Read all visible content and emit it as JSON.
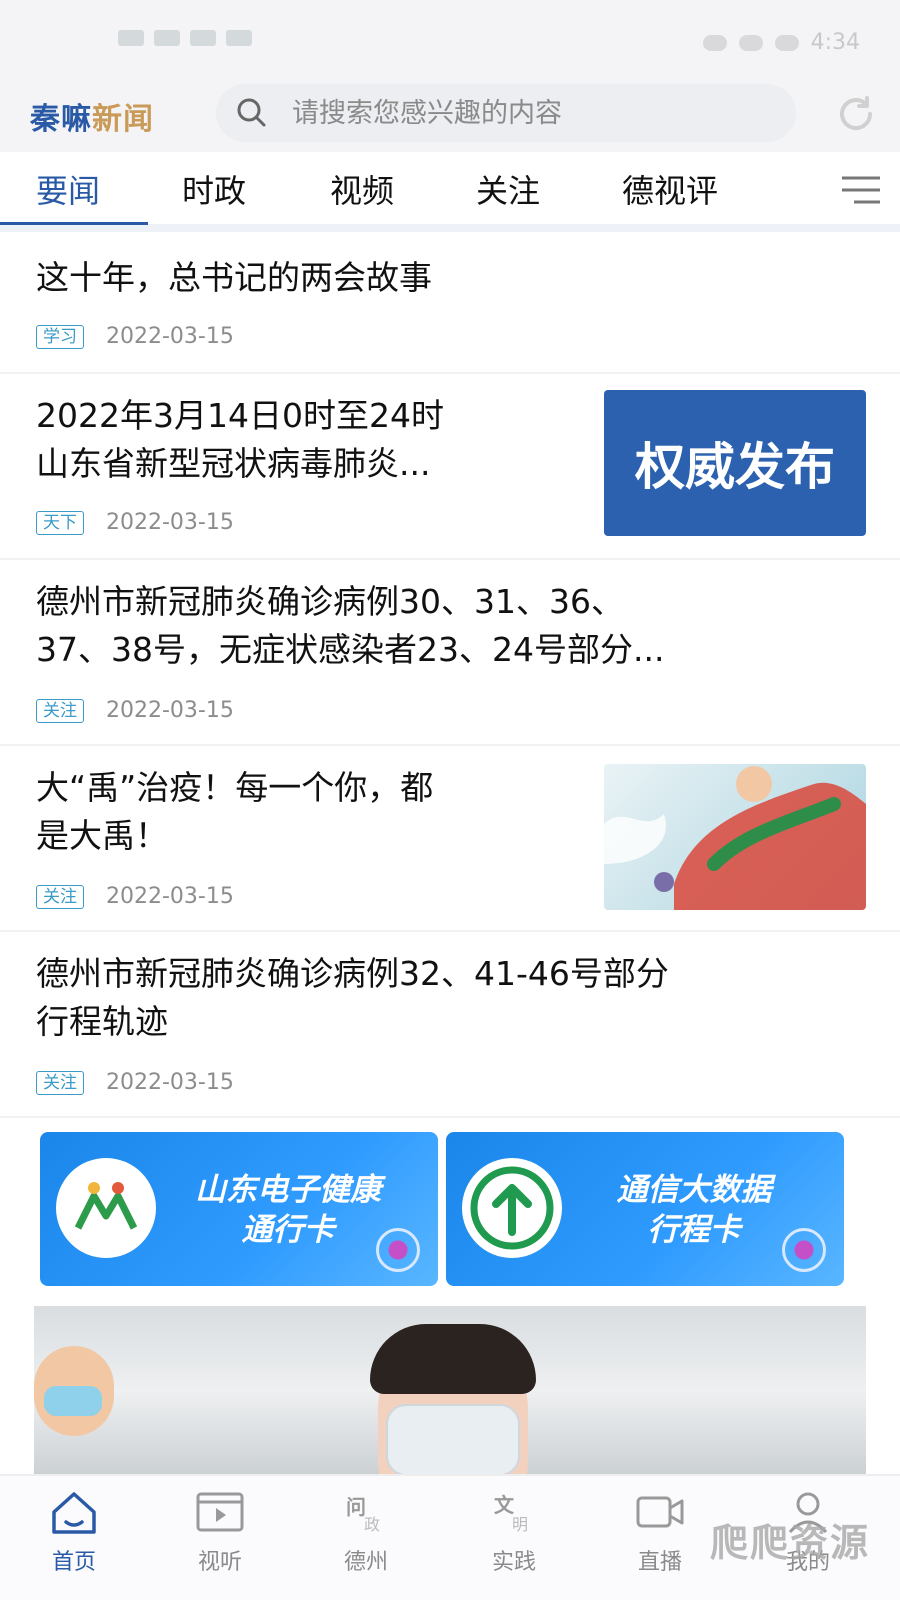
{
  "status_bar": {
    "time": "4:34"
  },
  "header": {
    "logo_part1": "秦嘛",
    "logo_part2": "新闻",
    "search_placeholder": "请搜索您感兴趣的内容"
  },
  "tabs": [
    {
      "label": "要闻",
      "active": true
    },
    {
      "label": "时政"
    },
    {
      "label": "视频"
    },
    {
      "label": "关注"
    },
    {
      "label": "德视评"
    }
  ],
  "news": [
    {
      "title_lines": [
        "这十年，总书记的两会故事"
      ],
      "tag": "学习",
      "date": "2022-03-15"
    },
    {
      "title_lines": [
        "2022年3月14日0时至24时",
        "山东省新型冠状病毒肺炎..."
      ],
      "tag": "天下",
      "date": "2022-03-15",
      "thumb_text": "权威发布"
    },
    {
      "title_lines": [
        "德州市新冠肺炎确诊病例30、31、36、",
        "37、38号，无症状感染者23、24号部分..."
      ],
      "tag": "关注",
      "date": "2022-03-15"
    },
    {
      "title_lines": [
        "大“禹”治疫！每一个你，都",
        "是大禹！"
      ],
      "tag": "关注",
      "date": "2022-03-15"
    },
    {
      "title_lines": [
        "德州市新冠肺炎确诊病例32、41-46号部分",
        "行程轨迹"
      ],
      "tag": "关注",
      "date": "2022-03-15"
    }
  ],
  "banners": [
    {
      "line1": "山东电子健康",
      "line2": "通行卡"
    },
    {
      "line1": "通信大数据",
      "line2": "行程卡"
    }
  ],
  "bottom_nav": [
    {
      "label": "首页",
      "icon": "home-icon",
      "active": true
    },
    {
      "label": "视听",
      "icon": "video-icon"
    },
    {
      "label": "德州",
      "icon": "wenzheng-icon"
    },
    {
      "label": "实践",
      "icon": "wenming-icon"
    },
    {
      "label": "直播",
      "icon": "camera-icon"
    },
    {
      "label": "我的",
      "icon": "user-icon"
    }
  ],
  "watermark": "爬爬资源",
  "colors": {
    "brand_blue": "#2a5aa6",
    "brand_gold": "#c99a58",
    "tag_blue": "#3a9bc8",
    "banner_blue": "#1b86ea"
  }
}
